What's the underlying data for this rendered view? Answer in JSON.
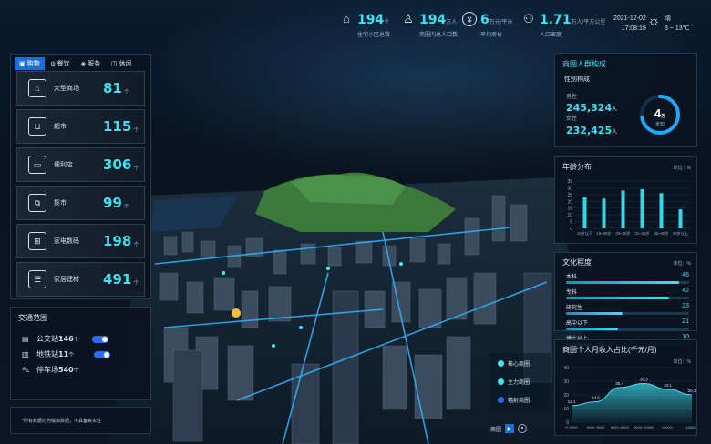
{
  "header": {
    "stats": [
      {
        "icon": "home-icon",
        "value": "194",
        "unit": "个",
        "label": "住宅小区总数"
      },
      {
        "icon": "person-icon",
        "value": "194",
        "unit": "万人",
        "label": "商圈内总人口数"
      },
      {
        "icon": "yen-icon",
        "value": "6",
        "unit": "万元/平米",
        "label": "平均房价"
      },
      {
        "icon": "people-icon",
        "value": "1.71",
        "unit": "万人/平方公里",
        "label": "人口密度"
      }
    ],
    "date": "2021-12-02",
    "time": "17:08:19",
    "weather": "晴",
    "temp": "8 ~ 13℃"
  },
  "left": {
    "tabs": [
      "购物",
      "餐饮",
      "服务",
      "休闲"
    ],
    "cards": [
      {
        "icon": "mall-icon",
        "label": "大型商场",
        "value": "81",
        "unit": "个"
      },
      {
        "icon": "cart-icon",
        "label": "超市",
        "value": "115",
        "unit": "个"
      },
      {
        "icon": "store-icon",
        "label": "便利店",
        "value": "306",
        "unit": "个"
      },
      {
        "icon": "market-icon",
        "label": "集市",
        "value": "99",
        "unit": "个"
      },
      {
        "icon": "appliance-icon",
        "label": "家电数码",
        "value": "198",
        "unit": "个"
      },
      {
        "icon": "furniture-icon",
        "label": "家居建材",
        "value": "491",
        "unit": "个"
      }
    ],
    "traffic": {
      "title": "交通范围",
      "rows": [
        {
          "icon": "bus-icon",
          "label": "公交站",
          "value": "146",
          "unit": "个"
        },
        {
          "icon": "subway-icon",
          "label": "地铁站",
          "value": "11",
          "unit": "个"
        },
        {
          "icon": "parking-icon",
          "label": "停车场",
          "value": "540",
          "unit": "个"
        }
      ]
    },
    "note": "*所有数据均为模拟数据，不具备真实性"
  },
  "right": {
    "crowd": {
      "title": "商圈人群构成",
      "sub": "性别构成",
      "male_label": "男性",
      "male": "245,324",
      "female_label": "女性",
      "female": "232,425",
      "unit": "人",
      "ring_value": "4",
      "ring_unit": "万",
      "ring_label": "未知",
      "ring_fraction": 0.72
    },
    "age": {
      "title": "年龄分布",
      "unit": "单位：%"
    },
    "edu": {
      "title": "文化程度",
      "unit": "单位：%",
      "rows": [
        {
          "label": "本科",
          "value": "46"
        },
        {
          "label": "专科",
          "value": "42"
        },
        {
          "label": "研究生",
          "value": "23"
        },
        {
          "label": "高中以下",
          "value": "21"
        },
        {
          "label": "博士以上",
          "value": "10"
        }
      ]
    },
    "income": {
      "title": "商圈个人月收入占比(千元/月)",
      "unit": "单位：%"
    }
  },
  "map": {
    "legend": [
      {
        "label": "核心商圈",
        "color": "#3fe0f0"
      },
      {
        "label": "主力商圈",
        "color": "#3fe0f0"
      },
      {
        "label": "辐射商圈",
        "color": "#2b6cff"
      }
    ],
    "controls_label": "商圈"
  },
  "chart_data": [
    {
      "type": "bar",
      "title": "年龄分布",
      "ylabel": "单位：%",
      "categories": [
        "19岁以下",
        "19~25岁",
        "26~30岁",
        "31~35岁",
        "36~40岁",
        "40岁以上"
      ],
      "values": [
        23,
        22,
        28,
        29,
        26,
        14
      ],
      "ylim": [
        0,
        35
      ],
      "yticks": [
        0,
        5,
        10,
        15,
        20,
        25,
        30,
        35
      ]
    },
    {
      "type": "area",
      "title": "商圈个人月收入占比(千元/月)",
      "ylabel": "单位：%",
      "categories": [
        "0~3000",
        "3000~5000",
        "5000~8000",
        "8000~10000",
        "10000~",
        "15000~"
      ],
      "values": [
        12.1,
        14.9,
        25.4,
        28.3,
        24.1,
        20.1
      ],
      "ylim": [
        0,
        40
      ],
      "yticks": [
        0,
        10,
        20,
        30,
        40
      ]
    }
  ]
}
